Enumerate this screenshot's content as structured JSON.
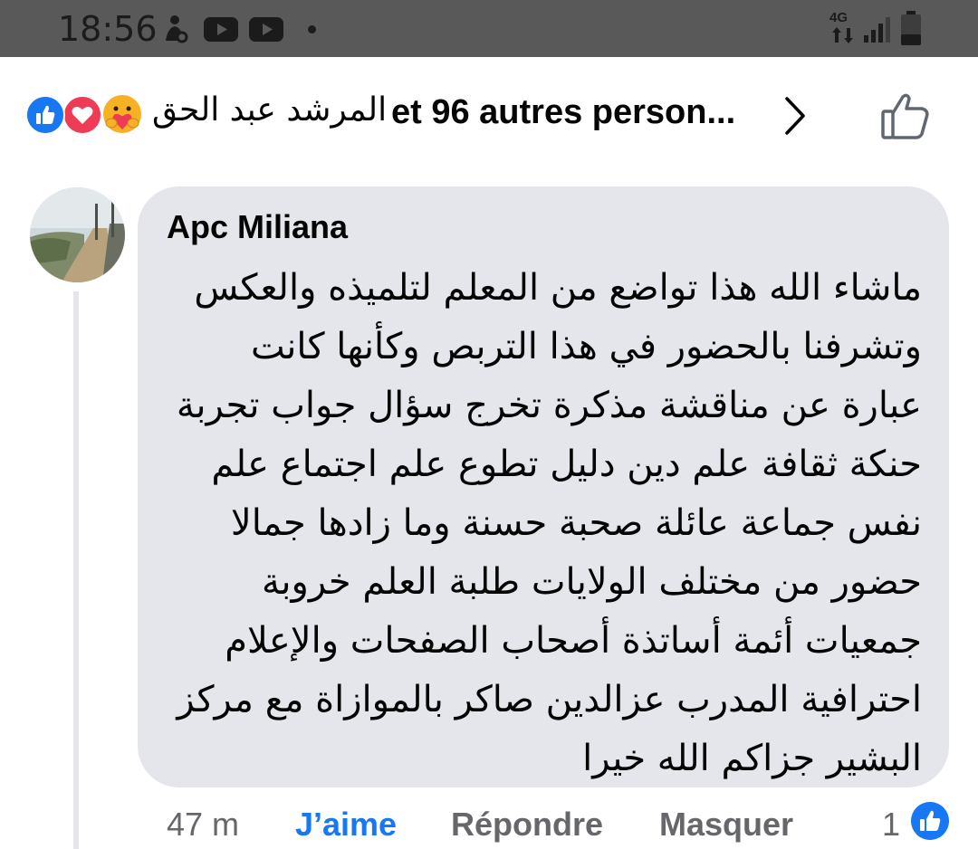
{
  "status_bar": {
    "time": "18:56",
    "network": "4G",
    "icons": [
      "settings-person-icon",
      "youtube-icon",
      "youtube-icon",
      "notification-dot",
      "network-arrows-icon",
      "signal-icon",
      "battery-icon"
    ]
  },
  "reactions": {
    "icons": [
      "like-reaction-icon",
      "love-reaction-icon",
      "care-reaction-icon"
    ],
    "names": "المرشد عبد الحق",
    "others": "et 96 autres person..."
  },
  "comment": {
    "author": "Apc Miliana",
    "text": "ماشاء الله هذا تواضع من المعلم لتلميذه والعكس وتشرفنا بالحضور في هذا التربص وكأنها كانت عبارة عن مناقشة مذكرة تخرج سؤال جواب تجربة حنكة ثقافة علم دين دليل تطوع علم اجتماع علم نفس جماعة عائلة صحبة حسنة وما زادها جمالا حضور من مختلف الولايات طلبة العلم خروبة جمعيات أئمة أساتذة أصحاب الصفحات والإعلام احترافية المدرب عزالدين صاكر بالموازاة مع مركز البشير جزاكم الله خيرا",
    "time_ago": "47 m",
    "like_label": "J’aime",
    "reply_label": "Répondre",
    "hide_label": "Masquer",
    "like_count": "1"
  },
  "colors": {
    "accent": "#1877f2",
    "love": "#ef3b55",
    "bubble": "#e4e6eb",
    "secondary_text": "#65676b",
    "status_bar": "#595959"
  }
}
